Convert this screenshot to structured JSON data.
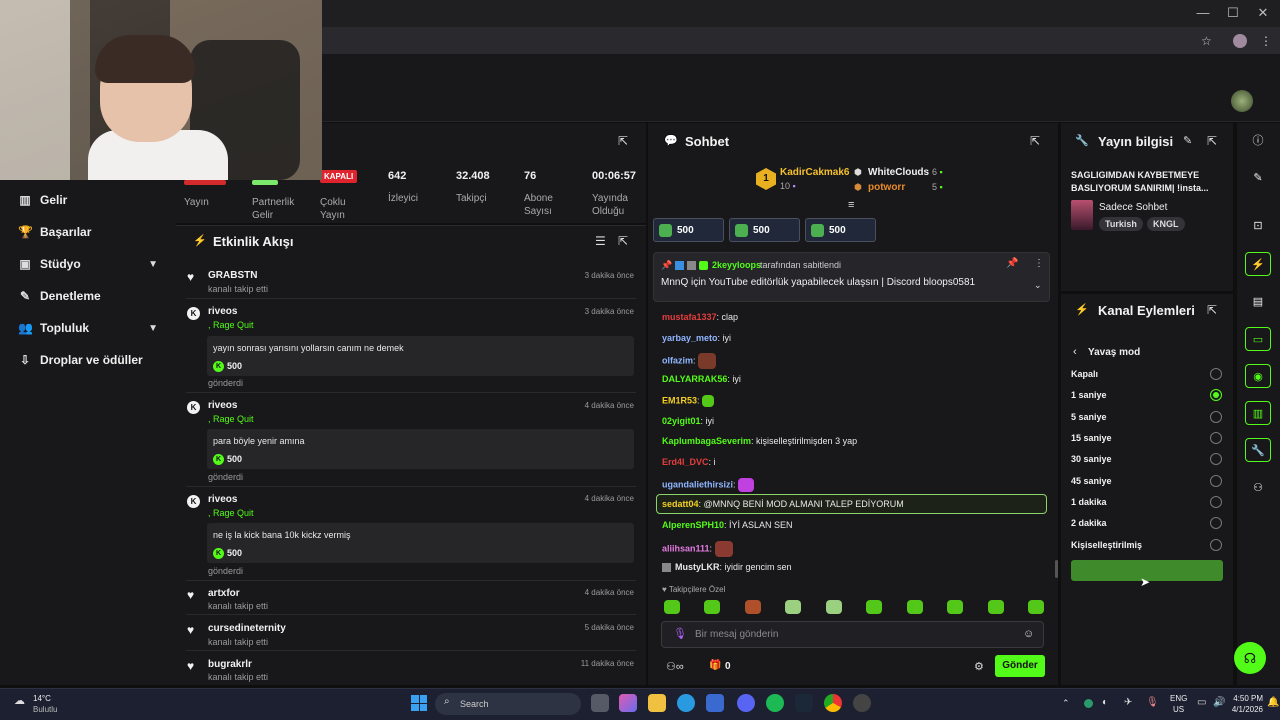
{
  "browser": {
    "min": "—",
    "max": "☐",
    "close": "✕"
  },
  "nav": {
    "items": [
      {
        "label": "Gelir",
        "icon": "▥"
      },
      {
        "label": "Başarılar",
        "icon": "🏆"
      },
      {
        "label": "Stüdyo",
        "icon": "▣"
      },
      {
        "label": "Denetleme",
        "icon": "✎"
      },
      {
        "label": "Topluluk",
        "icon": "👥"
      },
      {
        "label": "Droplar ve ödüller",
        "icon": "⇩"
      }
    ]
  },
  "stats": {
    "yayin": "Yayın",
    "partnerlik": "Partnerlik Gelir",
    "kapali_badge": "KAPALI",
    "coklu": "Çoklu Yayın",
    "izleyici_num": "642",
    "izleyici": "İzleyici",
    "takipci_num": "32.408",
    "takipci": "Takipçi",
    "abone_num": "76",
    "abone": "Abone Sayısı",
    "sure_num": "00:06:57",
    "sure": "Yayında Olduğu"
  },
  "activity": {
    "title": "Etkinlik Akışı",
    "events": [
      {
        "name": "GRABSTN",
        "sub": "kanalı takip etti",
        "time": "3 dakika önce"
      },
      {
        "name": "riveos",
        "sub": ", Rage Quit",
        "time": "3 dakika önce",
        "msg": "yayın sonrası yarısını yollarsın canım ne demek",
        "amount": "500",
        "footer": "gönderdi"
      },
      {
        "name": "riveos",
        "sub": ", Rage Quit",
        "time": "4 dakika önce",
        "msg": "para böyle yenir amına",
        "amount": "500",
        "footer": "gönderdi"
      },
      {
        "name": "riveos",
        "sub": ", Rage Quit",
        "time": "4 dakika önce",
        "msg": "ne iş la kick bana 10k kickz vermiş",
        "amount": "500",
        "footer": "gönderdi"
      },
      {
        "name": "artxfor",
        "sub": "kanalı takip etti",
        "time": "4 dakika önce"
      },
      {
        "name": "cursedineternity",
        "sub": "kanalı takip etti",
        "time": "5 dakika önce"
      },
      {
        "name": "bugrakrlr",
        "sub": "kanalı takip etti",
        "time": "11 dakika önce"
      }
    ]
  },
  "chat": {
    "title": "Sohbet",
    "leaders": [
      {
        "rank": "1",
        "name": "KadirCakmak6",
        "count": "10"
      },
      {
        "name": "WhiteClouds",
        "count": "6"
      },
      {
        "name": "potworr",
        "count": "5"
      }
    ],
    "gifts": [
      "500",
      "500",
      "500"
    ],
    "pinned": {
      "by_user": "2keyyloops",
      "by_text": "tarafından sabitlendi",
      "text": "MnnQ için YouTube editörlük yapabilecek ulaşsın | Discord bloops0581"
    },
    "messages": [
      {
        "user": "mustafa1337",
        "text": ": clap",
        "color": "#e23e3e"
      },
      {
        "user": "yarbay_meto",
        "text": ": iyi",
        "color": "#8fb6ff"
      },
      {
        "user": "olfazim",
        "text": ":",
        "color": "#8fb6ff"
      },
      {
        "user": "DALYARRAK56",
        "text": ": iyi",
        "color": "#53fc18"
      },
      {
        "user": "EM1R53",
        "text": ":",
        "color": "#f5d020"
      },
      {
        "user": "02yigit01",
        "text": ": iyi",
        "color": "#53fc18"
      },
      {
        "user": "KaplumbagaSeverim",
        "text": ": kişiselleştirilmişden 3 yap",
        "color": "#53fc18"
      },
      {
        "user": "Erd4l_DVC",
        "text": ": i",
        "color": "#e23e3e"
      },
      {
        "user": "ugandaliethirsizi",
        "text": ":",
        "color": "#8fb6ff"
      },
      {
        "user": "sedatt04",
        "text": ": @MNNQ BENİ MOD ALMANI TALEP EDİYORUM",
        "color": "#f5d020"
      },
      {
        "user": "AlperenSPH10",
        "text": ": İYİ ASLAN SEN",
        "color": "#53fc18"
      },
      {
        "user": "aliihsan111",
        "text": ":",
        "color": "#e27ae2"
      },
      {
        "user": "MustyLKR",
        "text": ": iyidir gencim sen",
        "color": "#eaeaea"
      }
    ],
    "followers_only": "Takipçilere Özel",
    "input_placeholder": "Bir mesaj gönderin",
    "viewers_count": "0",
    "send": "Gönder"
  },
  "streaminfo": {
    "title": "Yayın bilgisi",
    "stream_title": "SAGLIGIMDAN KAYBETMEYE BASLIYORUM SANIRIM| !insta...",
    "category": "Sadece Sohbet",
    "tags": [
      "Turkish",
      "KNGL"
    ]
  },
  "channelactions": {
    "title": "Kanal Eylemleri",
    "back": "Yavaş mod",
    "options": [
      "Kapalı",
      "1 saniye",
      "5 saniye",
      "15 saniye",
      "30 saniye",
      "45 saniye",
      "1 dakika",
      "2 dakika",
      "Kişiselleştirilmiş"
    ],
    "selected": 1
  },
  "taskbar": {
    "temp": "14°C",
    "weather": "Bulutlu",
    "search": "Search",
    "lang1": "ENG",
    "lang2": "US",
    "time": "4:50 PM",
    "date": "4/1/2026"
  }
}
